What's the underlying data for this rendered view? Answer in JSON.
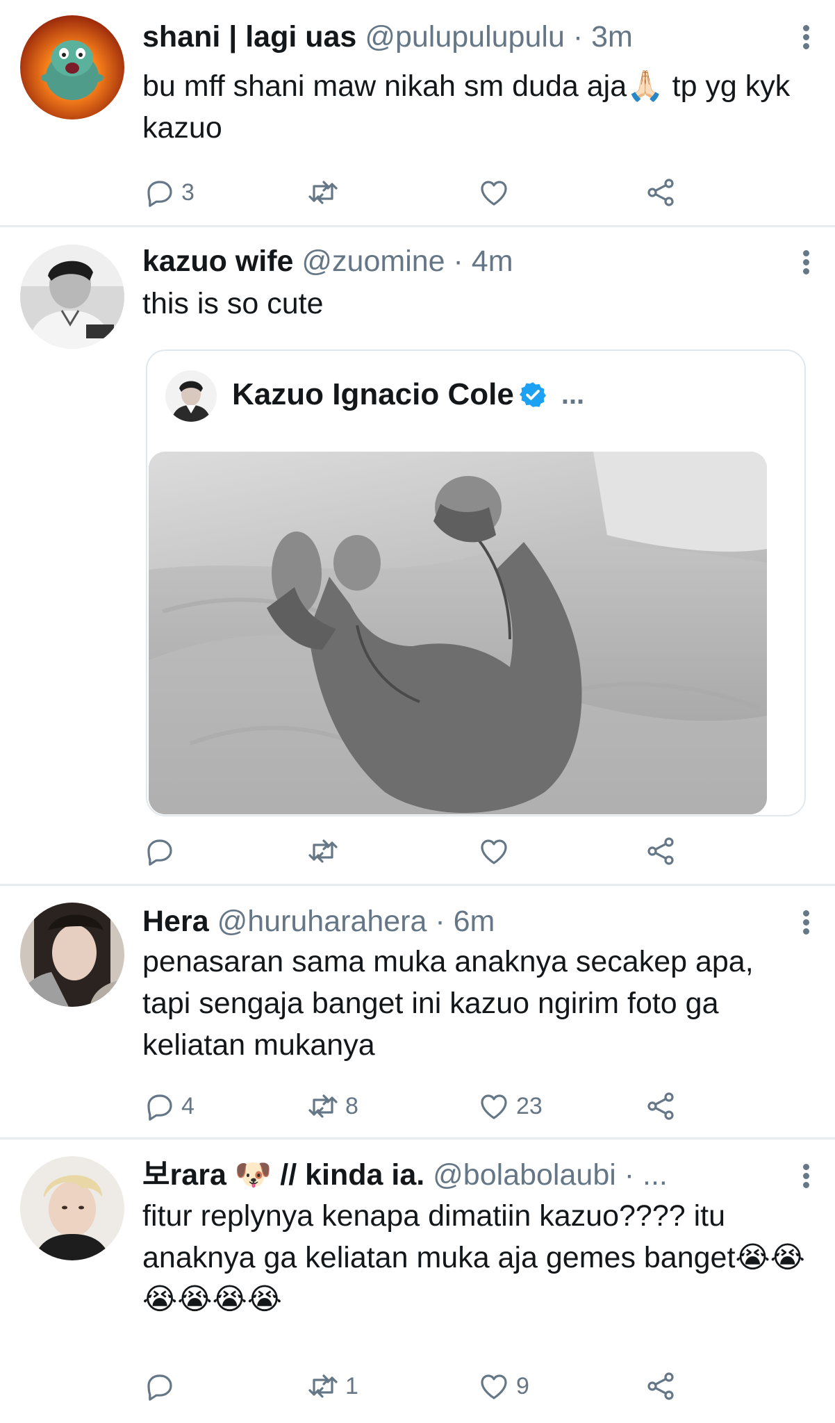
{
  "tweets": [
    {
      "name": "shani | lagi uas",
      "handle": "@pulupulupulu",
      "time": "· 3m",
      "text": "bu mff shani maw nikah sm duda aja🙏🏻 tp yg kyk kazuo",
      "replies": "3",
      "retweets": "",
      "likes": ""
    },
    {
      "name": "kazuo wife",
      "handle": "@zuomine",
      "time": "· 4m",
      "text": "this is so cute",
      "replies": "",
      "retweets": "",
      "likes": "",
      "quote": {
        "name": "Kazuo Ignacio Cole",
        "more": "..."
      }
    },
    {
      "name": "Hera",
      "handle": "@huruharahera",
      "time": "· 6m",
      "text": "penasaran sama muka anaknya secakep apa, tapi sengaja banget ini kazuo ngirim foto ga keliatan mukanya",
      "replies": "4",
      "retweets": "8",
      "likes": "23"
    },
    {
      "name": "보rara 🐶 // kinda ia.",
      "handle": "@bolabolaubi",
      "time": "· ...",
      "text": "fitur replynya kenapa dimatiin kazuo???? itu anaknya ga keliatan muka aja gemes banget😭😭😭😭😭😭",
      "replies": "",
      "retweets": "1",
      "likes": "9"
    }
  ],
  "icons": {
    "reply": "reply-icon",
    "retweet": "retweet-icon",
    "like": "heart-icon",
    "share": "share-icon",
    "more": "more-vertical-icon",
    "verified": "verified-badge-icon"
  },
  "colors": {
    "text": "#14171a",
    "secondary": "#657786",
    "divider": "#e6ecf0",
    "verified": "#1da1f2"
  }
}
